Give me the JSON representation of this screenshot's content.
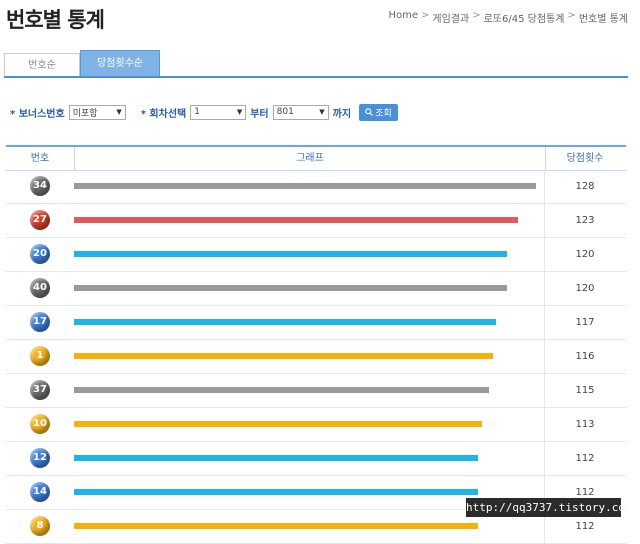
{
  "page": {
    "title": "번호별 통계"
  },
  "breadcrumb": [
    "Home",
    "게임결과",
    "로또6/45 당첨통계",
    "번호별 통계"
  ],
  "tabs": [
    {
      "label": "번호순",
      "active": false
    },
    {
      "label": "당첨횟수순",
      "active": true
    }
  ],
  "filters": {
    "bonus_label": "* 보너스번호",
    "bonus_value": "미포함",
    "round_label": "* 회차선택",
    "round_from": "1",
    "from_text": "부터",
    "round_to": "801",
    "to_text": "까지",
    "search_label": "조회"
  },
  "table": {
    "headers": {
      "number": "번호",
      "graph": "그래프",
      "count": "당첨횟수"
    },
    "max_count": 128,
    "rows": [
      {
        "number": "34",
        "count": 128,
        "color": "#9a9a9a"
      },
      {
        "number": "27",
        "count": 123,
        "color": "#e05a5a"
      },
      {
        "number": "20",
        "count": 120,
        "color": "#1fb4e6"
      },
      {
        "number": "40",
        "count": 120,
        "color": "#9a9a9a"
      },
      {
        "number": "17",
        "count": 117,
        "color": "#1fb4e6"
      },
      {
        "number": "1",
        "count": 116,
        "color": "#f3b10a"
      },
      {
        "number": "37",
        "count": 115,
        "color": "#9a9a9a"
      },
      {
        "number": "10",
        "count": 113,
        "color": "#f3b10a"
      },
      {
        "number": "12",
        "count": 112,
        "color": "#1fb4e6"
      },
      {
        "number": "14",
        "count": 112,
        "color": "#1fb4e6"
      },
      {
        "number": "8",
        "count": 112,
        "color": "#f3b10a"
      }
    ]
  },
  "ball_colors": {
    "yellow": "#f2b21b",
    "blue": "#3b7fd6",
    "red": "#d6402f",
    "gray": "#6c6c6c"
  },
  "watermark": "http://qq3737.tistory.com"
}
